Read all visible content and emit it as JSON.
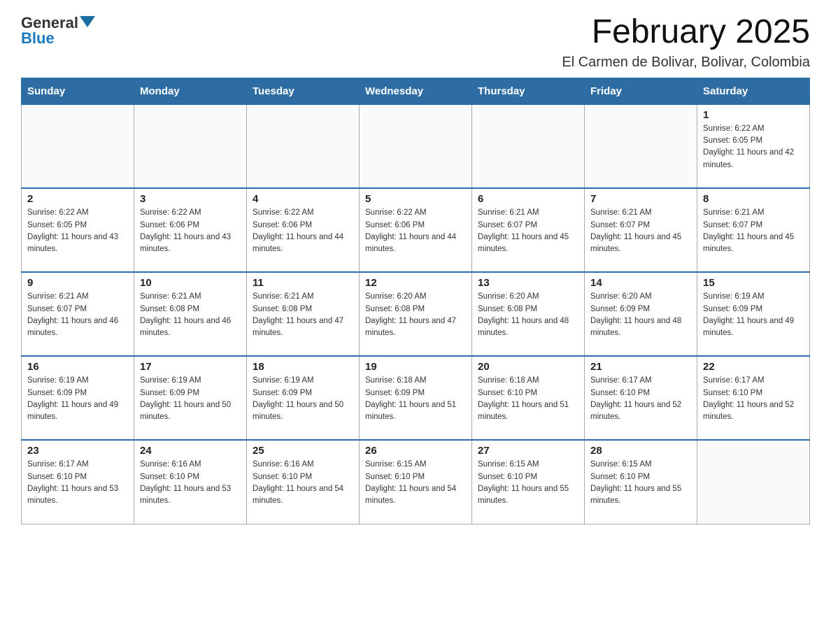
{
  "header": {
    "logo_text_general": "General",
    "logo_text_blue": "Blue",
    "month_title": "February 2025",
    "location": "El Carmen de Bolivar, Bolivar, Colombia"
  },
  "calendar": {
    "days_of_week": [
      "Sunday",
      "Monday",
      "Tuesday",
      "Wednesday",
      "Thursday",
      "Friday",
      "Saturday"
    ],
    "weeks": [
      {
        "days": [
          {
            "num": "",
            "info": ""
          },
          {
            "num": "",
            "info": ""
          },
          {
            "num": "",
            "info": ""
          },
          {
            "num": "",
            "info": ""
          },
          {
            "num": "",
            "info": ""
          },
          {
            "num": "",
            "info": ""
          },
          {
            "num": "1",
            "info": "Sunrise: 6:22 AM\nSunset: 6:05 PM\nDaylight: 11 hours and 42 minutes."
          }
        ]
      },
      {
        "days": [
          {
            "num": "2",
            "info": "Sunrise: 6:22 AM\nSunset: 6:05 PM\nDaylight: 11 hours and 43 minutes."
          },
          {
            "num": "3",
            "info": "Sunrise: 6:22 AM\nSunset: 6:06 PM\nDaylight: 11 hours and 43 minutes."
          },
          {
            "num": "4",
            "info": "Sunrise: 6:22 AM\nSunset: 6:06 PM\nDaylight: 11 hours and 44 minutes."
          },
          {
            "num": "5",
            "info": "Sunrise: 6:22 AM\nSunset: 6:06 PM\nDaylight: 11 hours and 44 minutes."
          },
          {
            "num": "6",
            "info": "Sunrise: 6:21 AM\nSunset: 6:07 PM\nDaylight: 11 hours and 45 minutes."
          },
          {
            "num": "7",
            "info": "Sunrise: 6:21 AM\nSunset: 6:07 PM\nDaylight: 11 hours and 45 minutes."
          },
          {
            "num": "8",
            "info": "Sunrise: 6:21 AM\nSunset: 6:07 PM\nDaylight: 11 hours and 45 minutes."
          }
        ]
      },
      {
        "days": [
          {
            "num": "9",
            "info": "Sunrise: 6:21 AM\nSunset: 6:07 PM\nDaylight: 11 hours and 46 minutes."
          },
          {
            "num": "10",
            "info": "Sunrise: 6:21 AM\nSunset: 6:08 PM\nDaylight: 11 hours and 46 minutes."
          },
          {
            "num": "11",
            "info": "Sunrise: 6:21 AM\nSunset: 6:08 PM\nDaylight: 11 hours and 47 minutes."
          },
          {
            "num": "12",
            "info": "Sunrise: 6:20 AM\nSunset: 6:08 PM\nDaylight: 11 hours and 47 minutes."
          },
          {
            "num": "13",
            "info": "Sunrise: 6:20 AM\nSunset: 6:08 PM\nDaylight: 11 hours and 48 minutes."
          },
          {
            "num": "14",
            "info": "Sunrise: 6:20 AM\nSunset: 6:09 PM\nDaylight: 11 hours and 48 minutes."
          },
          {
            "num": "15",
            "info": "Sunrise: 6:19 AM\nSunset: 6:09 PM\nDaylight: 11 hours and 49 minutes."
          }
        ]
      },
      {
        "days": [
          {
            "num": "16",
            "info": "Sunrise: 6:19 AM\nSunset: 6:09 PM\nDaylight: 11 hours and 49 minutes."
          },
          {
            "num": "17",
            "info": "Sunrise: 6:19 AM\nSunset: 6:09 PM\nDaylight: 11 hours and 50 minutes."
          },
          {
            "num": "18",
            "info": "Sunrise: 6:19 AM\nSunset: 6:09 PM\nDaylight: 11 hours and 50 minutes."
          },
          {
            "num": "19",
            "info": "Sunrise: 6:18 AM\nSunset: 6:09 PM\nDaylight: 11 hours and 51 minutes."
          },
          {
            "num": "20",
            "info": "Sunrise: 6:18 AM\nSunset: 6:10 PM\nDaylight: 11 hours and 51 minutes."
          },
          {
            "num": "21",
            "info": "Sunrise: 6:17 AM\nSunset: 6:10 PM\nDaylight: 11 hours and 52 minutes."
          },
          {
            "num": "22",
            "info": "Sunrise: 6:17 AM\nSunset: 6:10 PM\nDaylight: 11 hours and 52 minutes."
          }
        ]
      },
      {
        "days": [
          {
            "num": "23",
            "info": "Sunrise: 6:17 AM\nSunset: 6:10 PM\nDaylight: 11 hours and 53 minutes."
          },
          {
            "num": "24",
            "info": "Sunrise: 6:16 AM\nSunset: 6:10 PM\nDaylight: 11 hours and 53 minutes."
          },
          {
            "num": "25",
            "info": "Sunrise: 6:16 AM\nSunset: 6:10 PM\nDaylight: 11 hours and 54 minutes."
          },
          {
            "num": "26",
            "info": "Sunrise: 6:15 AM\nSunset: 6:10 PM\nDaylight: 11 hours and 54 minutes."
          },
          {
            "num": "27",
            "info": "Sunrise: 6:15 AM\nSunset: 6:10 PM\nDaylight: 11 hours and 55 minutes."
          },
          {
            "num": "28",
            "info": "Sunrise: 6:15 AM\nSunset: 6:10 PM\nDaylight: 11 hours and 55 minutes."
          },
          {
            "num": "",
            "info": ""
          }
        ]
      }
    ]
  }
}
